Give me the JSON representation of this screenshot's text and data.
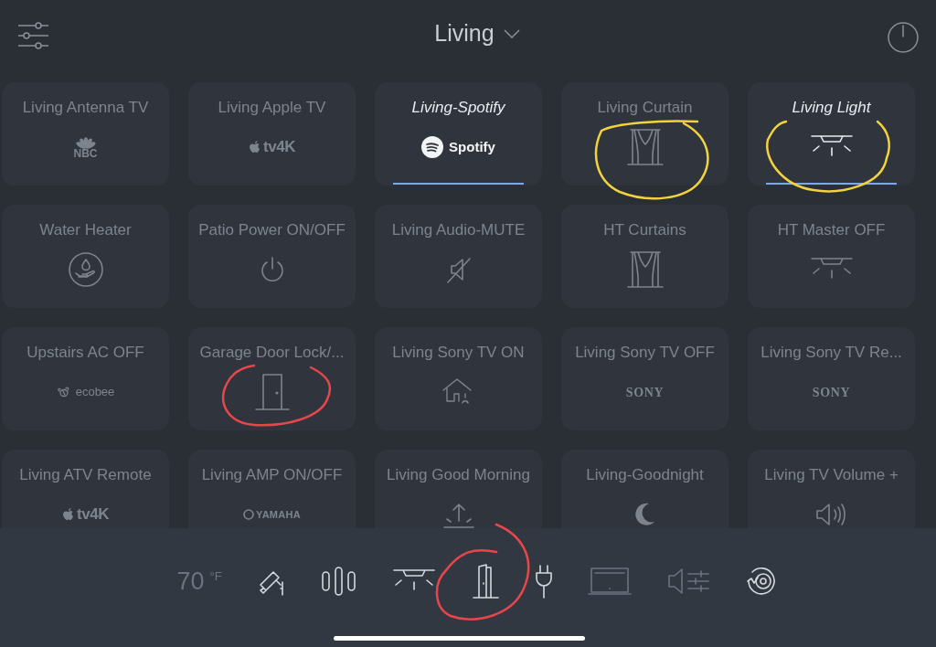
{
  "header": {
    "title": "Living"
  },
  "tiles": [
    {
      "title": "Living Antenna TV",
      "kind": "nbc",
      "logo_text": "NBC",
      "selected": false
    },
    {
      "title": "Living Apple TV",
      "kind": "appletv",
      "logo_text": "tv4K",
      "selected": false
    },
    {
      "title": "Living-Spotify",
      "kind": "spotify",
      "logo_text": "Spotify",
      "selected": true
    },
    {
      "title": "Living Curtain",
      "kind": "curtain",
      "selected": false
    },
    {
      "title": "Living Light",
      "kind": "light",
      "selected": true
    },
    {
      "title": "Water Heater",
      "kind": "water",
      "selected": false
    },
    {
      "title": "Patio Power ON/OFF",
      "kind": "power",
      "selected": false
    },
    {
      "title": "Living Audio-MUTE",
      "kind": "mute",
      "selected": false
    },
    {
      "title": "HT Curtains",
      "kind": "curtain",
      "selected": false
    },
    {
      "title": "HT Master OFF",
      "kind": "light",
      "selected": false
    },
    {
      "title": "Upstairs AC OFF",
      "kind": "ecobee",
      "logo_text": "ecobee",
      "selected": false
    },
    {
      "title": "Garage Door Lock/...",
      "kind": "door",
      "selected": false
    },
    {
      "title": "Living Sony TV ON",
      "kind": "house",
      "selected": false
    },
    {
      "title": "Living Sony TV OFF",
      "kind": "sony",
      "logo_text": "SONY",
      "selected": false
    },
    {
      "title": "Living Sony TV Re...",
      "kind": "sony",
      "logo_text": "SONY",
      "selected": false
    },
    {
      "title": "Living ATV Remote",
      "kind": "appletv",
      "logo_text": "tv4K",
      "selected": false
    },
    {
      "title": "Living AMP ON/OFF",
      "kind": "yamaha",
      "logo_text": "YAMAHA",
      "selected": false
    },
    {
      "title": "Living Good Morning",
      "kind": "sunrise",
      "selected": false
    },
    {
      "title": "Living-Goodnight",
      "kind": "moon",
      "selected": false
    },
    {
      "title": "Living TV Volume +",
      "kind": "volume",
      "selected": false
    }
  ],
  "bottom_bar": [
    {
      "kind": "temperature",
      "value": "70",
      "unit": "°F",
      "enabled": false
    },
    {
      "kind": "camera",
      "enabled": true
    },
    {
      "kind": "shades",
      "enabled": true
    },
    {
      "kind": "light",
      "enabled": true
    },
    {
      "kind": "door",
      "enabled": true
    },
    {
      "kind": "plug",
      "enabled": true
    },
    {
      "kind": "tv",
      "enabled": false
    },
    {
      "kind": "audio",
      "enabled": false
    },
    {
      "kind": "target",
      "enabled": true
    }
  ]
}
